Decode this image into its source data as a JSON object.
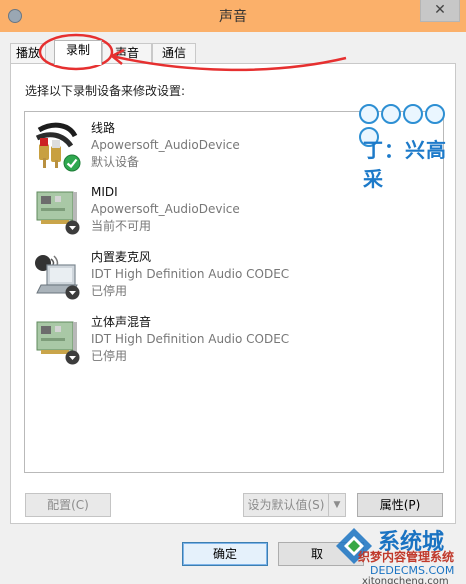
{
  "window": {
    "title": "声音",
    "close_glyph": "✕"
  },
  "tabs": [
    {
      "label": "播放",
      "active": false
    },
    {
      "label": "录制",
      "active": true
    },
    {
      "label": "声音",
      "active": false
    },
    {
      "label": "通信",
      "active": false
    }
  ],
  "instruction": "选择以下录制设备来修改设置:",
  "devices": [
    {
      "name": "线路",
      "driver": "Apowersoft_AudioDevice",
      "status": "默认设备",
      "icon": "line-in-icon",
      "badge": "default-check"
    },
    {
      "name": "MIDI",
      "driver": "Apowersoft_AudioDevice",
      "status": "当前不可用",
      "icon": "sound-card-icon",
      "badge": "down-arrow"
    },
    {
      "name": "内置麦克风",
      "driver": "IDT High Definition Audio CODEC",
      "status": "已停用",
      "icon": "laptop-microphone-icon",
      "badge": "down-arrow"
    },
    {
      "name": "立体声混音",
      "driver": "IDT High Definition Audio CODEC",
      "status": "已停用",
      "icon": "sound-card-icon",
      "badge": "down-arrow"
    }
  ],
  "buttons": {
    "configure": "配置(C)",
    "set_default": "设为默认值(S)",
    "properties": "属性(P)",
    "ok": "确定",
    "cancel": "取"
  },
  "watermark_top": {
    "text": "丁：兴高采"
  },
  "watermark_bottom": {
    "brand": "系统城",
    "line2": "织梦内容管理系统",
    "line3": "DEDECMS.COM",
    "line4": "xitongcheng.com"
  },
  "colors": {
    "titlebar": "#fbb06a",
    "annotation_red": "#e63030",
    "watermark_blue": "#1a73c2",
    "check_green": "#2fa84f"
  }
}
